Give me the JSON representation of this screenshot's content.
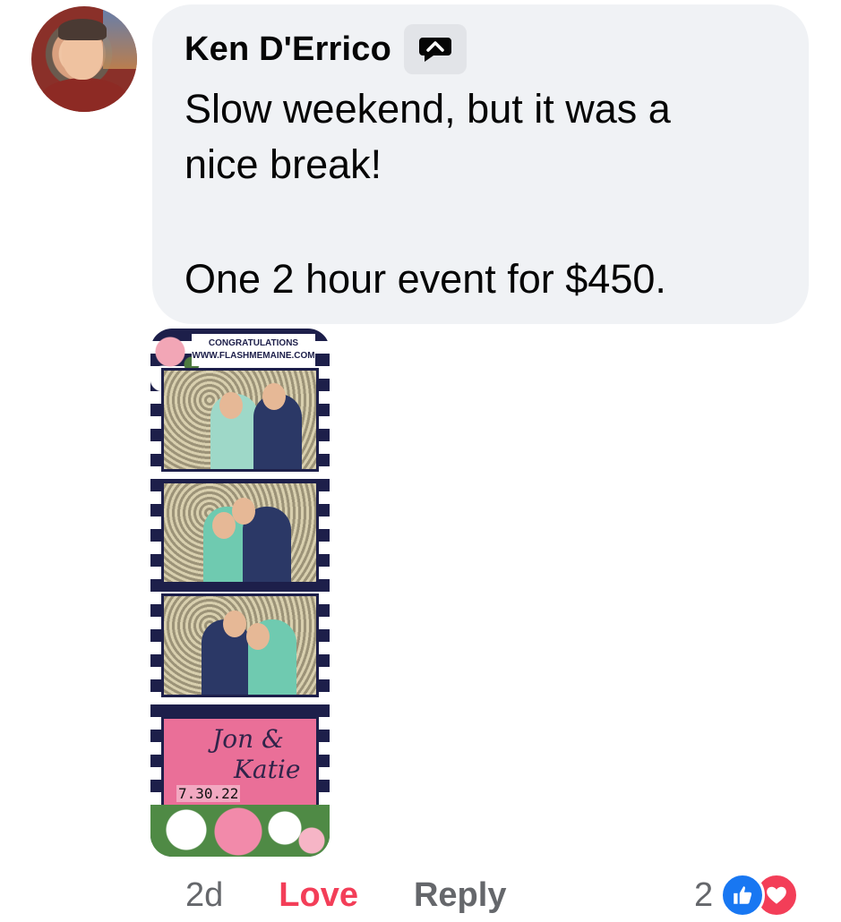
{
  "comment": {
    "author": "Ken D'Errico",
    "author_badge_icon": "speech-bubble-icon",
    "text_lines": [
      "Slow weekend, but it was a",
      "nice break!",
      "One 2 hour event for $450."
    ]
  },
  "photo_strip": {
    "header_line1": "CONGRATULATIONS",
    "header_line2": "WWW.FLASHMEMAINE.COM",
    "names_line1": "Jon &",
    "names_line2": "Katie",
    "date": "7.30.22"
  },
  "actions": {
    "time": "2d",
    "reaction_label": "Love",
    "reply_label": "Reply"
  },
  "reactions": {
    "count": "2",
    "types": [
      "like-icon",
      "love-icon"
    ],
    "colors": {
      "like": "#1877f2",
      "love": "#f33e58"
    }
  }
}
